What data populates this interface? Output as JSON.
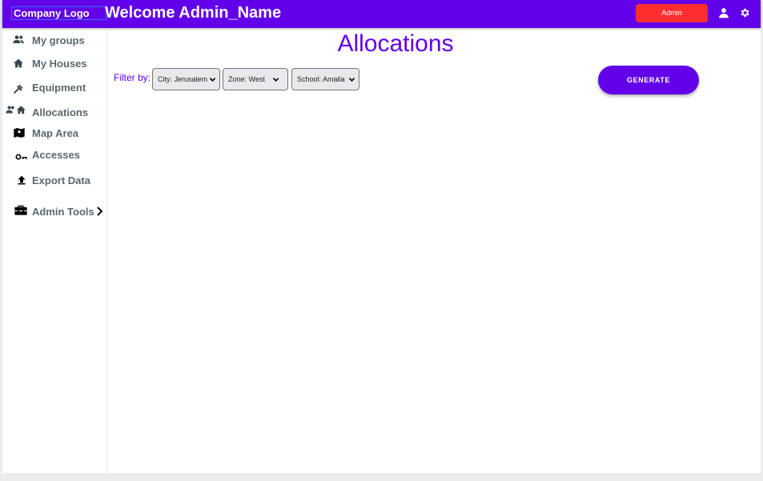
{
  "colors": {
    "primary": "#6200ea",
    "admin_badge": "#ff2e2e",
    "nav_text": "#5b6770",
    "background": "#ececec"
  },
  "header": {
    "logo_text": "Company Logo",
    "welcome_text": "Welcome Admin_Name",
    "admin_button_label": "Admin",
    "icons": [
      "user-icon",
      "gear-icon"
    ]
  },
  "sidebar": {
    "items": [
      {
        "label": "My groups",
        "icon": "groups-icon"
      },
      {
        "label": "My Houses",
        "icon": "house-icon"
      },
      {
        "label": "Equipment",
        "icon": "tools-icon"
      },
      {
        "label": "Allocations",
        "icon": "allocations-icon"
      },
      {
        "label": "Map Area",
        "icon": "map-icon"
      },
      {
        "label": "Accesses",
        "icon": "key-icon"
      },
      {
        "label": "Export Data",
        "icon": "upload-icon"
      },
      {
        "label": "Admin Tools",
        "icon": "toolbox-icon",
        "has_submenu": true
      }
    ]
  },
  "main": {
    "title": "Allocations",
    "filter_label": "Filter by:",
    "filters": [
      {
        "selected": "City: Jerusalem"
      },
      {
        "selected": "Zone: West"
      },
      {
        "selected": "School: Amalia"
      }
    ],
    "generate_label": "GENERATE"
  }
}
